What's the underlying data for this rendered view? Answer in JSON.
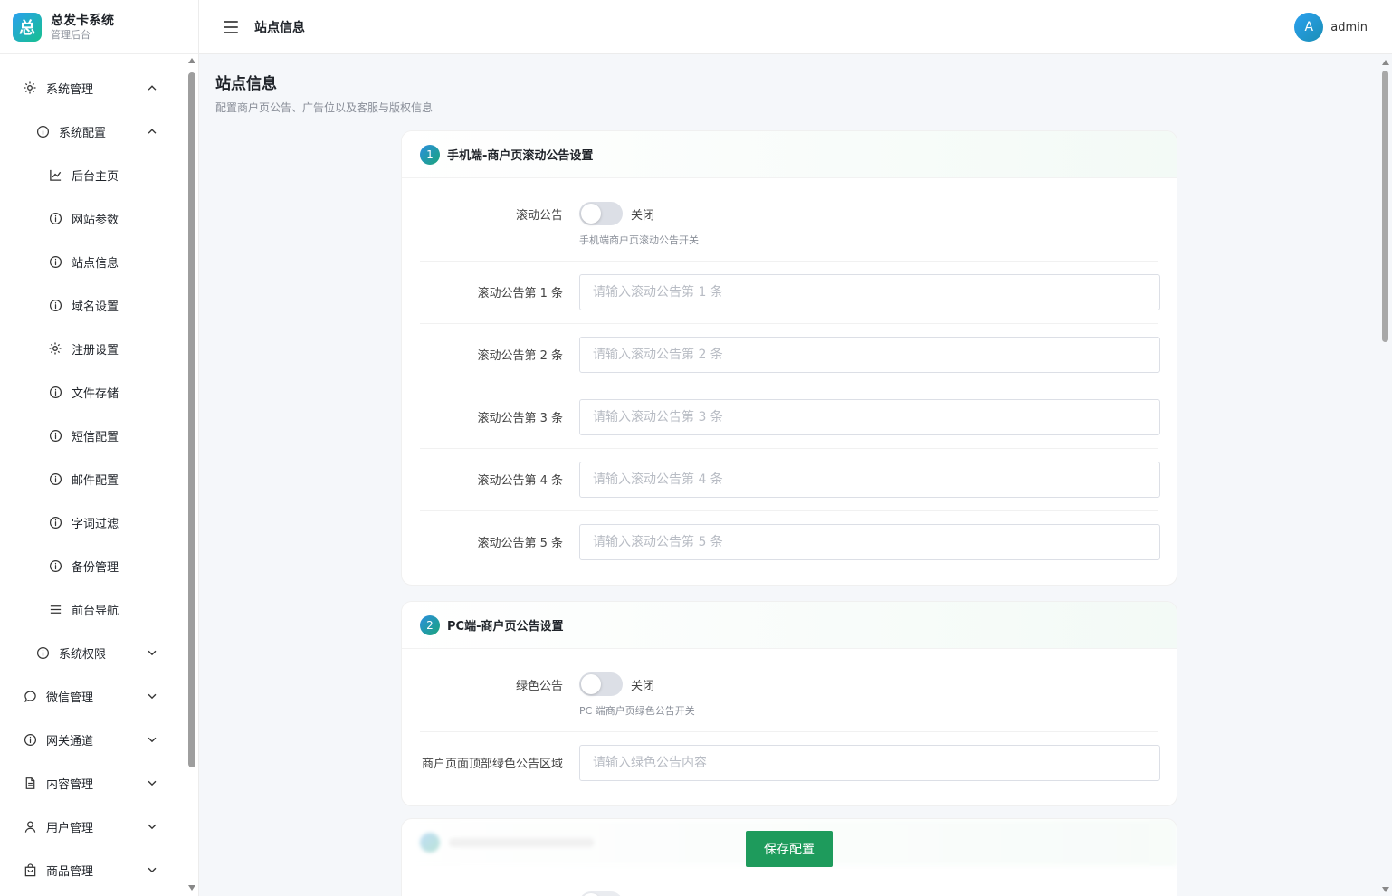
{
  "brand": {
    "logo": "总",
    "name": "总发卡系统",
    "sub": "管理后台"
  },
  "topbar": {
    "title": "站点信息",
    "avatar": "A",
    "username": "admin"
  },
  "sidebar": {
    "items": [
      {
        "label": "系统管理",
        "icon": "gear-icon",
        "level": 1,
        "chevron": "up"
      },
      {
        "label": "系统配置",
        "icon": "info-icon",
        "level": 2,
        "chevron": "up"
      },
      {
        "label": "后台主页",
        "icon": "chart-icon",
        "level": 3
      },
      {
        "label": "网站参数",
        "icon": "info-icon",
        "level": 3
      },
      {
        "label": "站点信息",
        "icon": "info-icon",
        "level": 3
      },
      {
        "label": "域名设置",
        "icon": "info-icon",
        "level": 3
      },
      {
        "label": "注册设置",
        "icon": "gear-icon",
        "level": 3
      },
      {
        "label": "文件存储",
        "icon": "info-icon",
        "level": 3
      },
      {
        "label": "短信配置",
        "icon": "info-icon",
        "level": 3
      },
      {
        "label": "邮件配置",
        "icon": "info-icon",
        "level": 3
      },
      {
        "label": "字词过滤",
        "icon": "info-icon",
        "level": 3
      },
      {
        "label": "备份管理",
        "icon": "info-icon",
        "level": 3
      },
      {
        "label": "前台导航",
        "icon": "menu-icon",
        "level": 3
      },
      {
        "label": "系统权限",
        "icon": "info-icon",
        "level": 2,
        "chevron": "down"
      },
      {
        "label": "微信管理",
        "icon": "chat-icon",
        "level": 1,
        "chevron": "down"
      },
      {
        "label": "网关通道",
        "icon": "info-icon",
        "level": 1,
        "chevron": "down"
      },
      {
        "label": "内容管理",
        "icon": "document-icon",
        "level": 1,
        "chevron": "down"
      },
      {
        "label": "用户管理",
        "icon": "user-icon",
        "level": 1,
        "chevron": "down"
      },
      {
        "label": "商品管理",
        "icon": "bag-icon",
        "level": 1,
        "chevron": "down"
      }
    ]
  },
  "page": {
    "title": "站点信息",
    "desc": "配置商户页公告、广告位以及客服与版权信息"
  },
  "section1": {
    "step": "1",
    "title": "手机端-商户页滚动公告设置",
    "toggle_label": "滚动公告",
    "toggle_state": "关闭",
    "toggle_hint": "手机端商户页滚动公告开关",
    "fields": [
      {
        "label": "滚动公告第 1 条",
        "placeholder": "请输入滚动公告第 1 条",
        "value": ""
      },
      {
        "label": "滚动公告第 2 条",
        "placeholder": "请输入滚动公告第 2 条",
        "value": ""
      },
      {
        "label": "滚动公告第 3 条",
        "placeholder": "请输入滚动公告第 3 条",
        "value": ""
      },
      {
        "label": "滚动公告第 4 条",
        "placeholder": "请输入滚动公告第 4 条",
        "value": ""
      },
      {
        "label": "滚动公告第 5 条",
        "placeholder": "请输入滚动公告第 5 条",
        "value": ""
      }
    ]
  },
  "section2": {
    "step": "2",
    "title": "PC端-商户页公告设置",
    "toggle_label": "绿色公告",
    "toggle_state": "关闭",
    "toggle_hint": "PC 端商户页绿色公告开关",
    "field": {
      "label": "商户页面顶部绿色公告区域",
      "placeholder": "请输入绿色公告内容",
      "value": ""
    }
  },
  "actions": {
    "save_label": "保存配置"
  },
  "colors": {
    "primary": "#1e9b5c",
    "accent_blue": "#2ba0f0"
  }
}
